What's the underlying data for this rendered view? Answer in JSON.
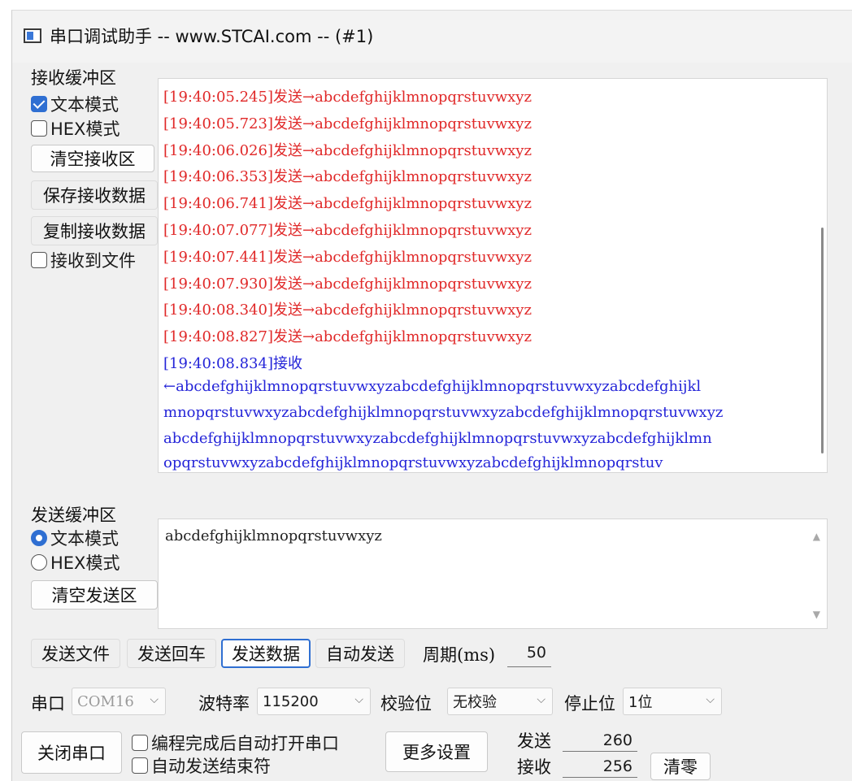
{
  "window": {
    "title": "串口调试助手 -- www.STCAI.com -- (#1)"
  },
  "receive": {
    "group_label": "接收缓冲区",
    "text_mode": "文本模式",
    "hex_mode": "HEX模式",
    "clear": "清空接收区",
    "save": "保存接收数据",
    "copy": "复制接收数据",
    "to_file": "接收到文件",
    "lines": [
      {
        "ts": "[19:40:05.245]",
        "dir": "发送",
        "arrow": "→",
        "text": "abcdefghijklmnopqrstuvwxyz"
      },
      {
        "ts": "[19:40:05.723]",
        "dir": "发送",
        "arrow": "→",
        "text": "abcdefghijklmnopqrstuvwxyz"
      },
      {
        "ts": "[19:40:06.026]",
        "dir": "发送",
        "arrow": "→",
        "text": "abcdefghijklmnopqrstuvwxyz"
      },
      {
        "ts": "[19:40:06.353]",
        "dir": "发送",
        "arrow": "→",
        "text": "abcdefghijklmnopqrstuvwxyz"
      },
      {
        "ts": "[19:40:06.741]",
        "dir": "发送",
        "arrow": "→",
        "text": "abcdefghijklmnopqrstuvwxyz"
      },
      {
        "ts": "[19:40:07.077]",
        "dir": "发送",
        "arrow": "→",
        "text": "abcdefghijklmnopqrstuvwxyz"
      },
      {
        "ts": "[19:40:07.441]",
        "dir": "发送",
        "arrow": "→",
        "text": "abcdefghijklmnopqrstuvwxyz"
      },
      {
        "ts": "[19:40:07.930]",
        "dir": "发送",
        "arrow": "→",
        "text": "abcdefghijklmnopqrstuvwxyz"
      },
      {
        "ts": "[19:40:08.340]",
        "dir": "发送",
        "arrow": "→",
        "text": "abcdefghijklmnopqrstuvwxyz"
      },
      {
        "ts": "[19:40:08.827]",
        "dir": "发送",
        "arrow": "→",
        "text": "abcdefghijklmnopqrstuvwxyz"
      }
    ],
    "recv_header": "[19:40:08.834]接收",
    "recv_lines": [
      "←abcdefghijklmnopqrstuvwxyzabcdefghijklmnopqrstuvwxyzabcdefghijkl",
      "mnopqrstuvwxyzabcdefghijklmnopqrstuvwxyzabcdefghijklmnopqrstuvwxyz",
      "abcdefghijklmnopqrstuvwxyzabcdefghijklmnopqrstuvwxyzabcdefghijklmn",
      "opqrstuvwxyzabcdefghijklmnopqrstuvwxyzabcdefghijklmnopqrstuv"
    ]
  },
  "send": {
    "group_label": "发送缓冲区",
    "text_mode": "文本模式",
    "hex_mode": "HEX模式",
    "clear": "清空发送区",
    "content": "abcdefghijklmnopqrstuvwxyz",
    "up_arrow": "▲",
    "down_arrow": "▼"
  },
  "toolbar": {
    "send_file": "发送文件",
    "send_enter": "发送回车",
    "send_data": "发送数据",
    "auto_send": "自动发送",
    "period_label": "周期(ms)",
    "period_value": "50"
  },
  "port": {
    "port_label": "串口",
    "port_value": "COM16",
    "baud_label": "波特率",
    "baud_value": "115200",
    "parity_label": "校验位",
    "parity_value": "无校验",
    "stop_label": "停止位",
    "stop_value": "1位",
    "close_port": "关闭串口",
    "auto_open": "编程完成后自动打开串口",
    "auto_end": "自动发送结束符",
    "more_settings": "更多设置",
    "sent_label": "发送",
    "sent_count": "260",
    "recv_label": "接收",
    "recv_count": "256",
    "clear_counts": "清零"
  },
  "colors": {
    "send_line": "#e02828",
    "recv_line": "#2424d8",
    "accent": "#2f6fd2"
  },
  "icons": {
    "dropdown": "chevron-down-icon",
    "app": "app-icon"
  }
}
